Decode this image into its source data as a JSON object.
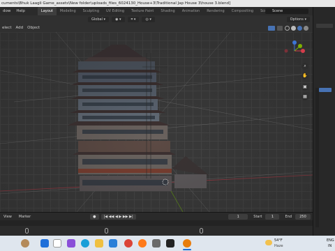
{
  "window": {
    "title": "cuments\\Bhuk Laagli Game_assets\\New folder\\uploads_files_6024130_House+3\\Traditional Jap House 3\\house 3.blend]"
  },
  "topmenu": {
    "items": [
      "dow",
      "Help"
    ]
  },
  "workspaces": [
    "Layout",
    "Modeling",
    "Sculpting",
    "UV Editing",
    "Texture Paint",
    "Shading",
    "Animation",
    "Rendering",
    "Compositing",
    "Scripting"
  ],
  "scene": {
    "label": "Scene"
  },
  "toolbar": {
    "orientation": "Global",
    "options": "Options"
  },
  "viewport_header": {
    "items": [
      "elect",
      "Add",
      "Object"
    ]
  },
  "timeline": {
    "view_label": "View",
    "marker_label": "Marker",
    "current_frame": "1",
    "start_label": "Start",
    "start_value": "1",
    "end_label": "End",
    "end_value": "250"
  },
  "taskbar": {
    "weather_temp": "54°F",
    "weather_desc": "Haze",
    "lang_top": "ENG",
    "lang_bottom": "IN"
  },
  "colors": {
    "accent": "#4772b3",
    "axis_x": "#d53d4b",
    "axis_y": "#7fb000",
    "axis_z": "#3d75d5"
  }
}
